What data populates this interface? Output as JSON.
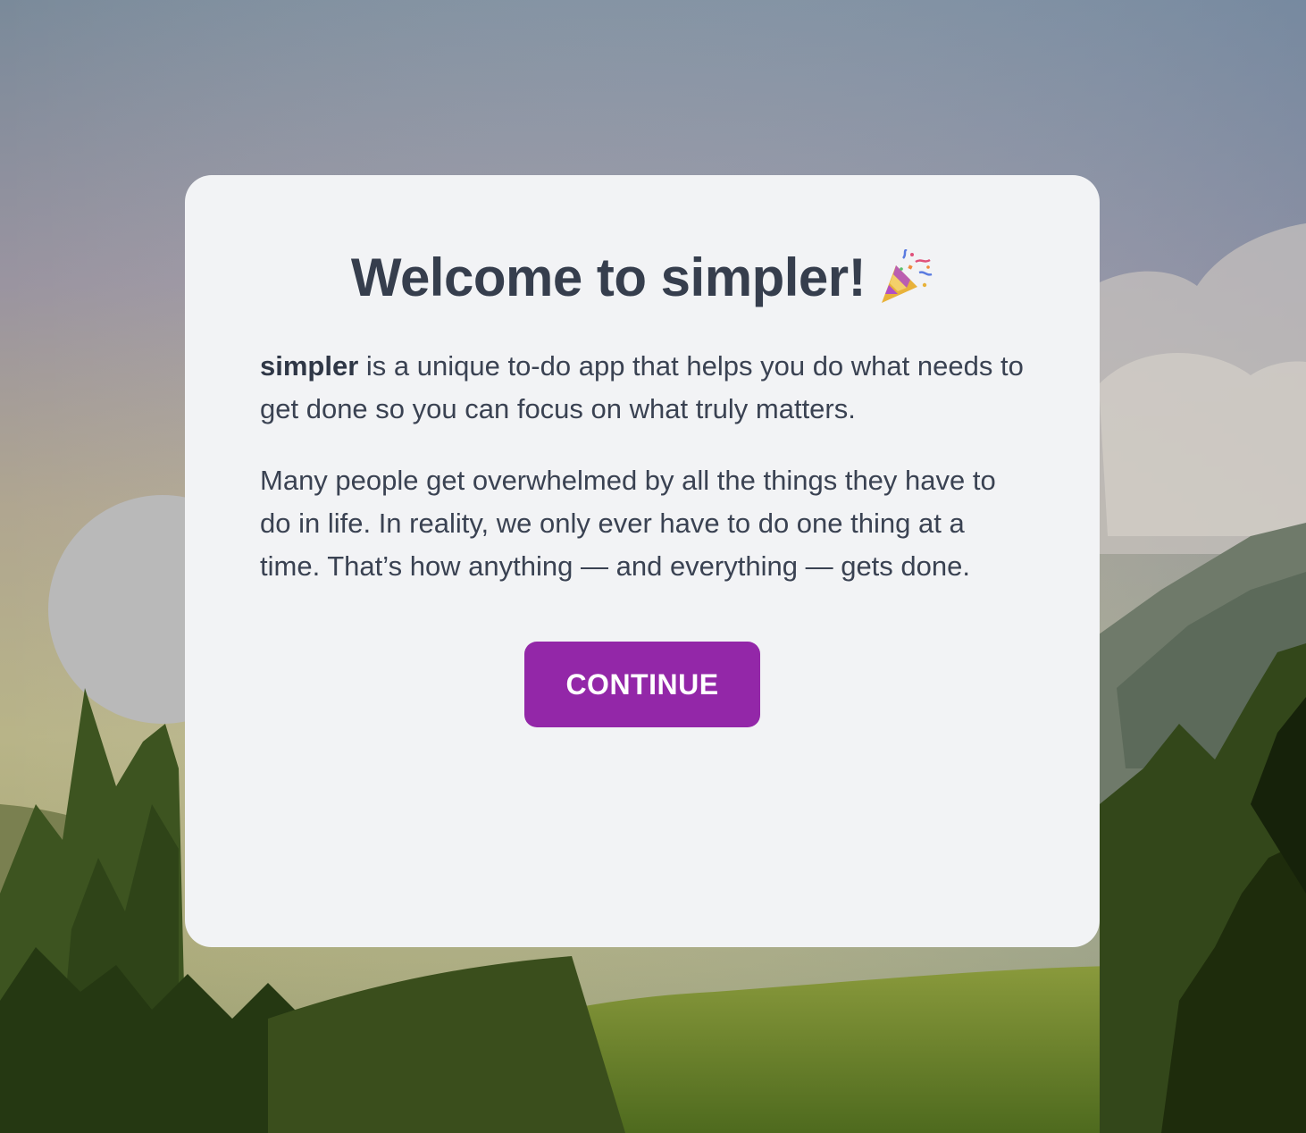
{
  "modal": {
    "title": "Welcome to simpler!",
    "title_icon": "party-popper-icon",
    "intro_brand": "simpler",
    "intro_rest": " is a unique to-do app that helps you do what needs to get done so you can focus on what truly matters.",
    "paragraph2": "Many people get overwhelmed by all the things they have to do in life. In reality, we only ever have to do one thing at a time. That’s how anything — and everything — gets done.",
    "continue_label": "CONTINUE"
  },
  "colors": {
    "accent": "#9327a8",
    "card_bg": "#f2f3f5",
    "text": "#384050"
  }
}
